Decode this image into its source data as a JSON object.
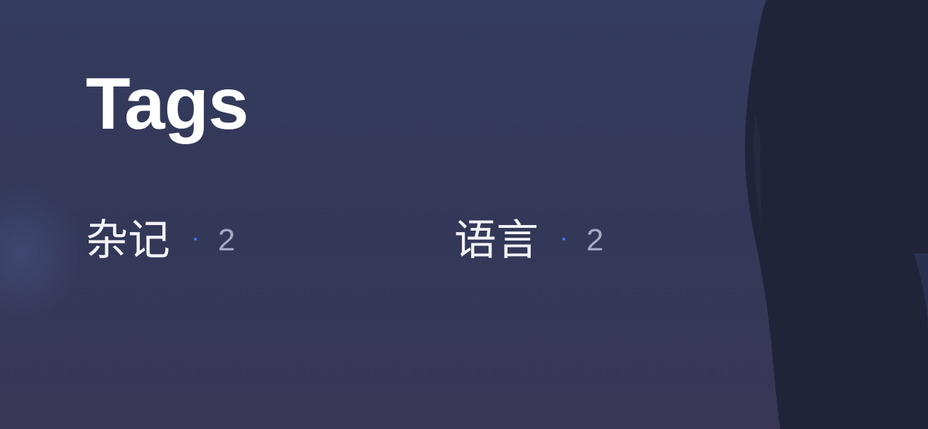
{
  "page": {
    "title": "Tags"
  },
  "tags": [
    {
      "name": "杂记",
      "count": "2"
    },
    {
      "name": "语言",
      "count": "2"
    }
  ],
  "colors": {
    "background": "#343858",
    "title": "#ffffff",
    "tag_text": "#f2f3f7",
    "count_text": "#a4abc4",
    "dot_accent": "#3a7bf2",
    "silhouette": "#1f2438"
  }
}
